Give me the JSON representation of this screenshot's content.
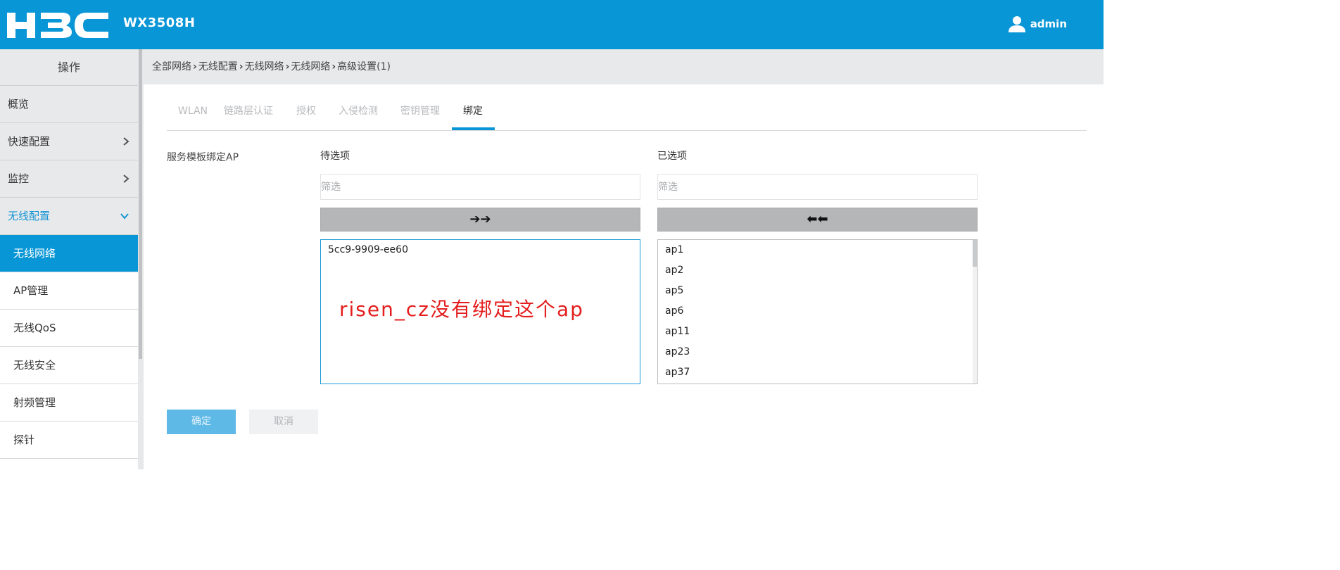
{
  "header": {
    "brand": "H3C",
    "model": "WX3508H",
    "user": "admin",
    "colors": {
      "bar": "#0896d6",
      "text": "#ffffff"
    }
  },
  "sidebar": {
    "title": "操作",
    "items": [
      {
        "label": "概览",
        "chevron": ""
      },
      {
        "label": "快速配置",
        "chevron": "chevron-right-icon"
      },
      {
        "label": "监控",
        "chevron": "chevron-right-icon"
      },
      {
        "label": "无线配置",
        "chevron": "chevron-down-icon"
      }
    ],
    "subitems": [
      {
        "label": "无线网络"
      },
      {
        "label": "AP管理"
      },
      {
        "label": "无线QoS"
      },
      {
        "label": "无线安全"
      },
      {
        "label": "射频管理"
      },
      {
        "label": "探针"
      }
    ]
  },
  "breadcrumb": [
    "全部网络",
    "无线配置",
    "无线网络",
    "无线网络",
    "高级设置(1)"
  ],
  "tabs": [
    "WLAN",
    "链路层认证",
    "授权",
    "入侵检测",
    "密钥管理",
    "绑定"
  ],
  "form": {
    "field_label": "服务模板绑定AP",
    "available_title": "待选项",
    "selected_title": "已选项",
    "filter_placeholder": "筛选",
    "move_right": "➔➔",
    "move_left": "⬅⬅",
    "available": [
      "5cc9-9909-ee60"
    ],
    "selected": [
      "ap1",
      "ap2",
      "ap5",
      "ap6",
      "ap11",
      "ap23",
      "ap37"
    ],
    "annotation": "risen_cz没有绑定这个ap",
    "ok_label": "确定",
    "cancel_label": "取消"
  }
}
